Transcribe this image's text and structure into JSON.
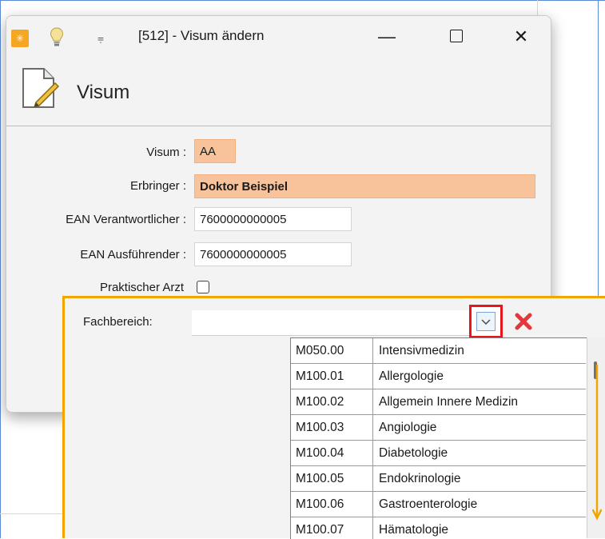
{
  "window": {
    "title": "[512] - Visum ändern",
    "minimize": "—",
    "close": "✕"
  },
  "header": {
    "title": "Visum"
  },
  "form": {
    "visum_label": "Visum :",
    "visum_value": "AA",
    "erbringer_label": "Erbringer :",
    "erbringer_value": "Doktor Beispiel",
    "ean_verantwortlicher_label": "EAN Verantwortlicher :",
    "ean_verantwortlicher_value": "7600000000005",
    "ean_ausfuehrender_label": "EAN  Ausführender :",
    "ean_ausfuehrender_value": "7600000000005",
    "praktischer_arzt_label": "Praktischer Arzt",
    "fachbereich_label": "Fachbereich:",
    "fachbereich_value": ""
  },
  "dropdown": {
    "items": [
      {
        "code": "M050.00",
        "name": "Intensivmedizin"
      },
      {
        "code": "M100.01",
        "name": "Allergologie"
      },
      {
        "code": "M100.02",
        "name": "Allgemein Innere Medizin"
      },
      {
        "code": "M100.03",
        "name": "Angiologie"
      },
      {
        "code": "M100.04",
        "name": "Diabetologie"
      },
      {
        "code": "M100.05",
        "name": "Endokrinologie"
      },
      {
        "code": "M100.06",
        "name": "Gastroenterologie"
      },
      {
        "code": "M100.07",
        "name": "Hämatologie"
      }
    ]
  },
  "colors": {
    "highlight_orange": "#f0a500",
    "highlight_red": "#e8151b",
    "field_orange": "#f8c39a",
    "clear_red": "#e2383c"
  }
}
